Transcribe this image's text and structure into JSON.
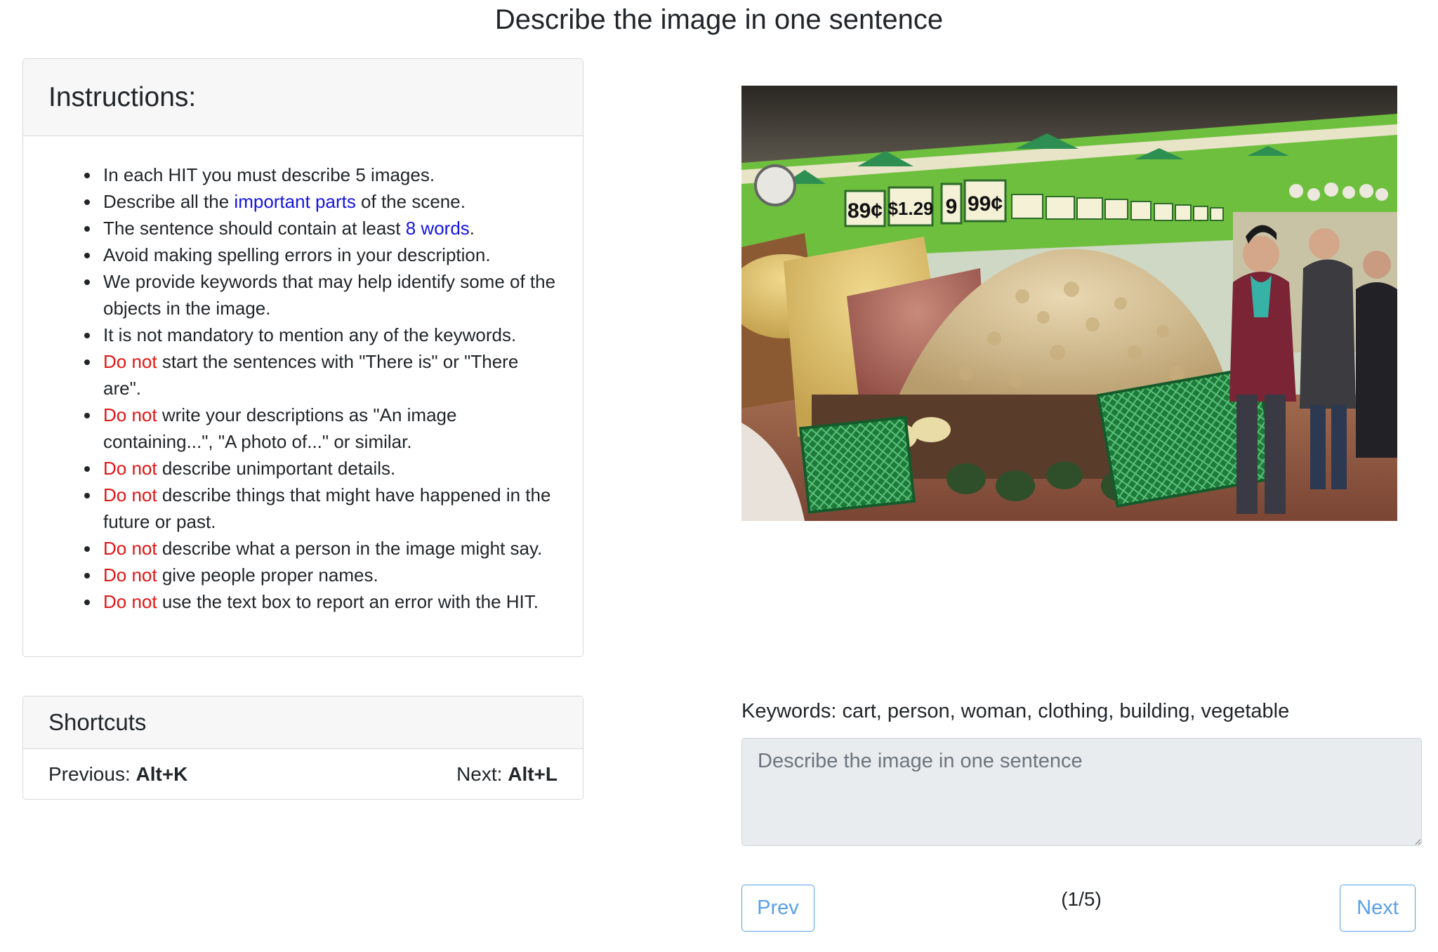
{
  "page": {
    "title": "Describe the image in one sentence"
  },
  "instructions": {
    "heading": "Instructions:",
    "items": [
      {
        "before": "In each HIT you must describe 5 images.",
        "hl": "",
        "after": "",
        "hl_color": ""
      },
      {
        "before": "Describe all the ",
        "hl": "important parts",
        "after": " of the scene.",
        "hl_color": "blue"
      },
      {
        "before": "The sentence should contain at least ",
        "hl": "8 words",
        "after": ".",
        "hl_color": "blue"
      },
      {
        "before": "Avoid making spelling errors in your description.",
        "hl": "",
        "after": "",
        "hl_color": ""
      },
      {
        "before": "We provide keywords that may help identify some of the objects in the image.",
        "hl": "",
        "after": "",
        "hl_color": ""
      },
      {
        "before": "It is not mandatory to mention any of the keywords.",
        "hl": "",
        "after": "",
        "hl_color": ""
      },
      {
        "before": "",
        "hl": "Do not",
        "after": " start the sentences with \"There is\" or \"There are\".",
        "hl_color": "red"
      },
      {
        "before": "",
        "hl": "Do not",
        "after": " write your descriptions as \"An image containing...\", \"A photo of...\" or similar.",
        "hl_color": "red"
      },
      {
        "before": "",
        "hl": "Do not",
        "after": " describe unimportant details.",
        "hl_color": "red"
      },
      {
        "before": "",
        "hl": "Do not",
        "after": " describe things that might have happened in the future or past.",
        "hl_color": "red"
      },
      {
        "before": "",
        "hl": "Do not",
        "after": " describe what a person in the image might say.",
        "hl_color": "red"
      },
      {
        "before": "",
        "hl": "Do not",
        "after": " give people proper names.",
        "hl_color": "red"
      },
      {
        "before": "",
        "hl": "Do not",
        "after": " use the text box to report an error with the HIT.",
        "hl_color": "red"
      }
    ]
  },
  "shortcuts": {
    "heading": "Shortcuts",
    "previous_label": "Previous: ",
    "previous_key": "Alt+K",
    "next_label": "Next: ",
    "next_key": "Alt+L"
  },
  "task": {
    "price_tags": [
      "89¢",
      "$1.29",
      "9",
      "99¢"
    ],
    "keywords_text": "Keywords: cart, person, woman, clothing, building, vegetable",
    "description_value": "",
    "description_placeholder": "Describe the image in one sentence",
    "prev_label": "Prev",
    "next_label": "Next",
    "progress": "(1/5)"
  },
  "colors": {
    "highlight_blue": "#1515e0",
    "highlight_red": "#e31515",
    "button_accent": "#5aa0e8"
  }
}
